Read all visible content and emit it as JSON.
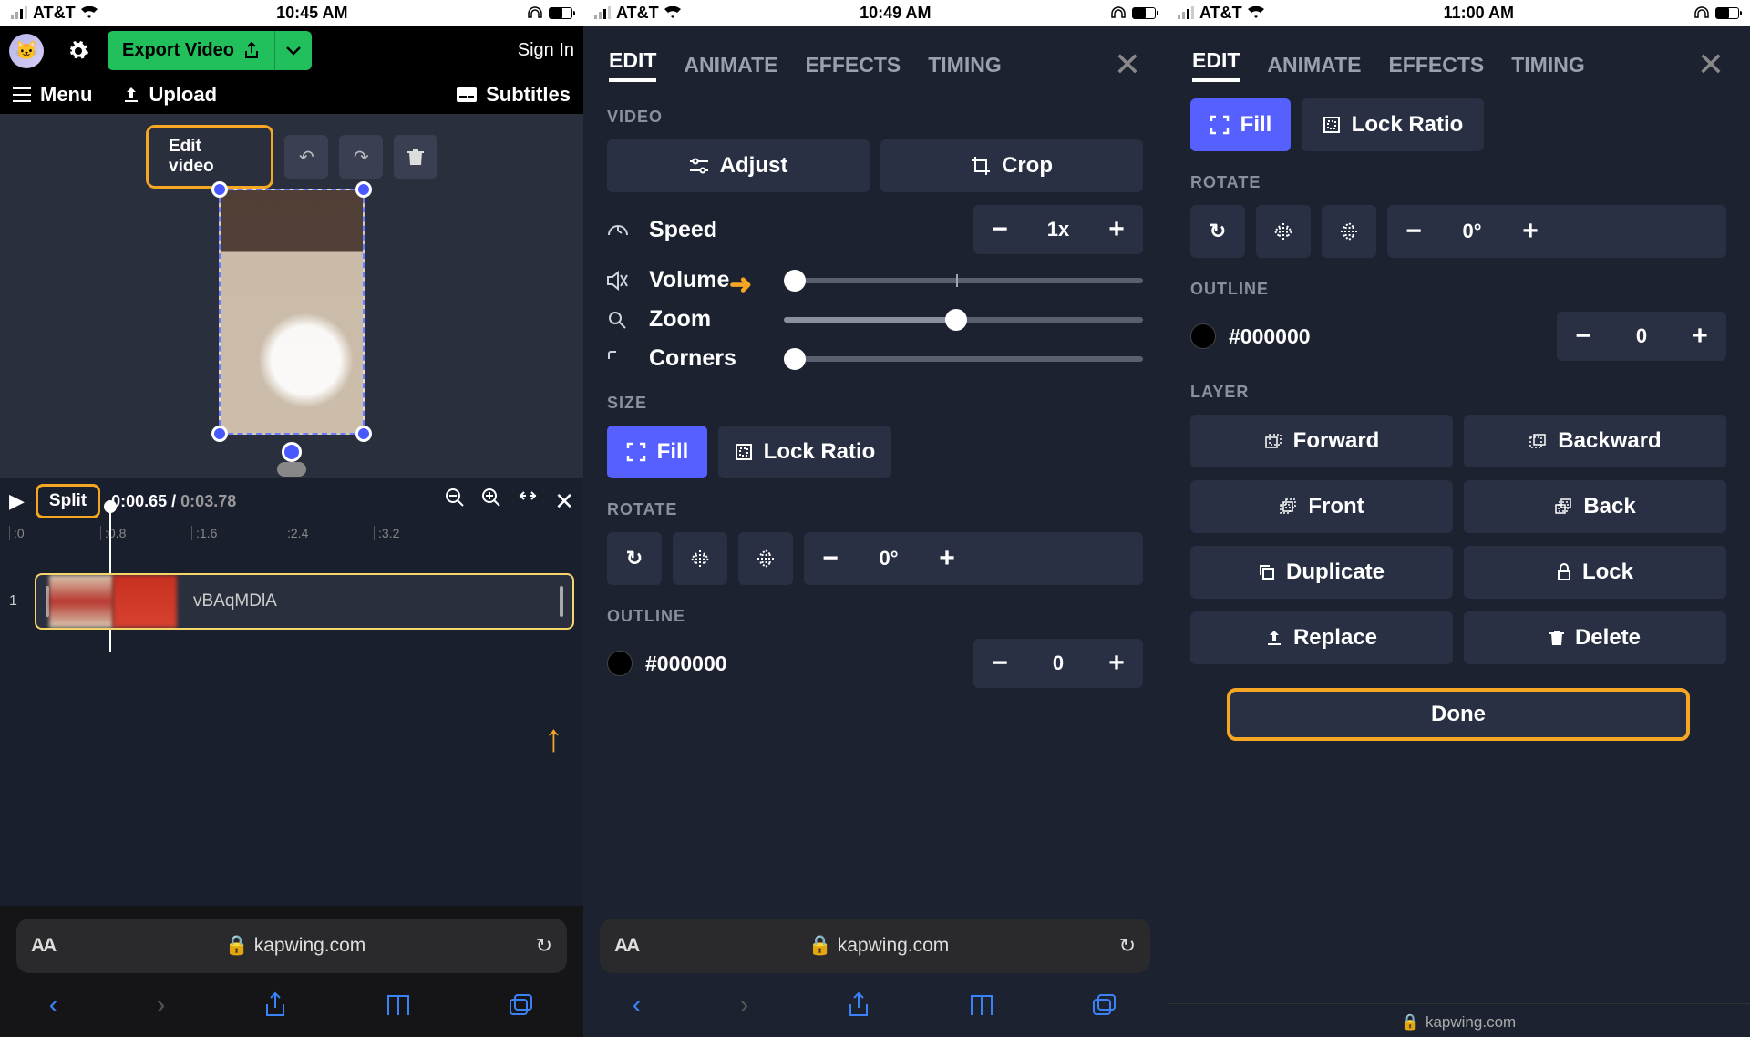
{
  "status": [
    {
      "carrier": "AT&T",
      "time": "10:45 AM"
    },
    {
      "carrier": "AT&T",
      "time": "10:49 AM"
    },
    {
      "carrier": "AT&T",
      "time": "11:00 AM"
    }
  ],
  "screen1": {
    "export_label": "Export Video",
    "signin": "Sign In",
    "menu": "Menu",
    "upload": "Upload",
    "subtitles": "Subtitles",
    "edit_video": "Edit video",
    "split": "Split",
    "time_current": "0:00.65",
    "time_sep": " / ",
    "time_total": "0:03.78",
    "ruler": [
      ":0",
      ":0.8",
      ":1.6",
      ":2.4",
      ":3.2"
    ],
    "track_num": "1",
    "clip_name": "vBAqMDlA",
    "url": "kapwing.com",
    "aa": "AA"
  },
  "panel_tabs": [
    "EDIT",
    "ANIMATE",
    "EFFECTS",
    "TIMING"
  ],
  "screen2": {
    "section_video": "VIDEO",
    "adjust": "Adjust",
    "crop": "Crop",
    "speed": "Speed",
    "speed_val": "1x",
    "volume": "Volume",
    "zoom": "Zoom",
    "corners": "Corners",
    "section_size": "SIZE",
    "fill": "Fill",
    "lock_ratio": "Lock Ratio",
    "section_rotate": "ROTATE",
    "rotate_val": "0°",
    "section_outline": "OUTLINE",
    "outline_color": "#000000",
    "outline_val": "0",
    "url": "kapwing.com",
    "aa": "AA"
  },
  "screen3": {
    "fill": "Fill",
    "lock_ratio": "Lock Ratio",
    "section_rotate": "ROTATE",
    "rotate_val": "0°",
    "section_outline": "OUTLINE",
    "outline_color": "#000000",
    "outline_val": "0",
    "section_layer": "LAYER",
    "forward": "Forward",
    "backward": "Backward",
    "front": "Front",
    "back": "Back",
    "duplicate": "Duplicate",
    "lock": "Lock",
    "replace": "Replace",
    "delete": "Delete",
    "done": "Done",
    "url": "kapwing.com"
  }
}
